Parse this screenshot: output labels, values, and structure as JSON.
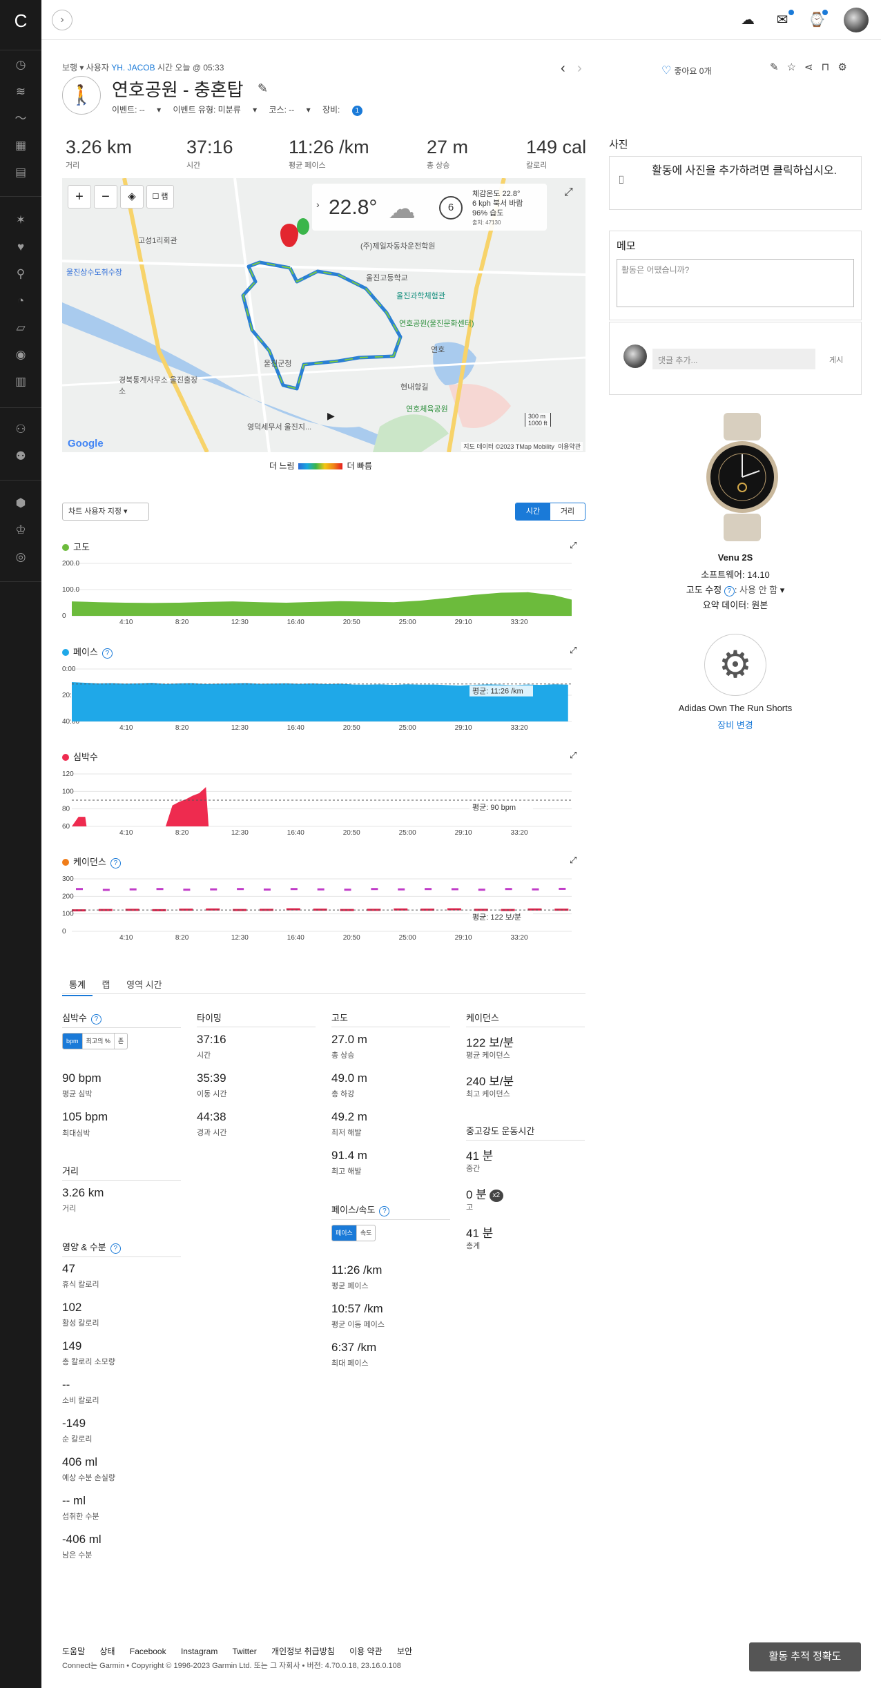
{
  "header": {
    "collapse_icon": "chevron-right-icon"
  },
  "breadcrumb": {
    "view": "보행",
    "user_prefix": "사용자",
    "user": "YH. JACOB",
    "time_prefix": "시간",
    "time": "오늘 @ 05:33"
  },
  "activity": {
    "title": "연호공원 - 충혼탑",
    "event": "이벤트: --",
    "event_type": "이벤트 유형: 미분류",
    "course": "코스: --",
    "gear": "장비:",
    "gear_count": "1",
    "likes": "좋아요 0개"
  },
  "stats": [
    {
      "value": "3.26 km",
      "label": "거리"
    },
    {
      "value": "37:16",
      "label": "시간"
    },
    {
      "value": "11:26 /km",
      "label": "평균 페이스"
    },
    {
      "value": "27 m",
      "label": "총 상승"
    },
    {
      "value": "149 cal",
      "label": "칼로리"
    }
  ],
  "map": {
    "lap_label": "랩",
    "weather": {
      "temp": "22.8°",
      "wind": "6",
      "feels": "체감온도 22.8°",
      "wind_text": "6 kph 북서 바람",
      "humidity": "96% 습도",
      "source": "출처: 47130"
    },
    "labels": {
      "a": "고성1리회관",
      "b": "울진상수도취수장",
      "c": "(주)제일자동차운전학원",
      "d": "울진고등학교",
      "e": "울진과학체험관",
      "f": "연호공원(울진문화센터)",
      "g": "경북통계사무소 울진출장소",
      "h": "영덕세무서 울진지...",
      "i": "연호체육공원",
      "j": "현내항길",
      "k": "연호",
      "l": "울진군청"
    },
    "credit": "지도 데이터 ©2023 TMap Mobility",
    "terms": "이용약관",
    "scale_m": "300 m",
    "scale_ft": "1000 ft",
    "google": "Google"
  },
  "speed_legend": {
    "slow": "더 느림",
    "fast": "더 빠름"
  },
  "chart_controls": {
    "settings": "차트 사용자 지정 ▾",
    "time": "시간",
    "distance": "거리"
  },
  "chart_data": [
    {
      "type": "area",
      "title": "고도",
      "color": "#6cbb3c",
      "x_ticks": [
        "4:10",
        "8:20",
        "12:30",
        "16:40",
        "20:50",
        "25:00",
        "29:10",
        "33:20"
      ],
      "y_ticks": [
        "200.0",
        "100.0",
        "0"
      ],
      "ylim": [
        0,
        200
      ],
      "x": [
        0,
        2,
        4,
        6,
        8,
        10,
        12,
        14,
        16,
        18,
        20,
        22,
        24,
        26,
        28,
        30,
        32,
        34,
        36,
        37.27
      ],
      "values": [
        55,
        52,
        50,
        49,
        50,
        53,
        55,
        52,
        50,
        53,
        56,
        54,
        52,
        58,
        68,
        80,
        88,
        90,
        78,
        62
      ]
    },
    {
      "type": "area",
      "title": "페이스",
      "color": "#1fa8e8",
      "x_ticks": [
        "4:10",
        "8:20",
        "12:30",
        "16:40",
        "20:50",
        "25:00",
        "29:10",
        "33:20"
      ],
      "y_ticks": [
        "0:00",
        "20:00",
        "40:00"
      ],
      "ylim": [
        0,
        40
      ],
      "avg_label": "평균: 11:26 /km",
      "x": [
        0,
        1,
        2,
        3,
        4,
        5,
        6,
        7,
        8,
        9,
        10,
        11,
        12,
        13,
        14,
        15,
        16,
        17,
        18,
        19,
        20,
        21,
        22,
        23,
        24,
        25,
        26,
        27,
        28,
        29,
        30,
        31,
        32,
        33,
        34,
        35,
        36,
        37
      ],
      "values": [
        10,
        10.5,
        11,
        10.8,
        11.2,
        11,
        10.6,
        11.4,
        11,
        10.8,
        11.5,
        11.2,
        11,
        10.7,
        11.3,
        11.1,
        10.9,
        11.4,
        11,
        11.6,
        11.2,
        11.9,
        12,
        11.8,
        12.2,
        11.7,
        12,
        11.9,
        12.3,
        12.6,
        12.1,
        11.8,
        12,
        12.4,
        11.9,
        12.2,
        11.7,
        12
      ]
    },
    {
      "type": "area",
      "title": "심박수",
      "color": "#ee2b4f",
      "x_ticks": [
        "4:10",
        "8:20",
        "12:30",
        "16:40",
        "20:50",
        "25:00",
        "29:10",
        "33:20"
      ],
      "y_ticks": [
        "120",
        "100",
        "80",
        "60"
      ],
      "ylim": [
        60,
        120
      ],
      "avg_label": "평균: 90 bpm",
      "x": [
        0,
        0.5,
        1,
        1.1,
        7,
        7.5,
        8,
        8.5,
        9,
        9.5,
        10,
        10.2
      ],
      "values": [
        60,
        71,
        71,
        60,
        60,
        84,
        88,
        91,
        95,
        98,
        105,
        60
      ]
    },
    {
      "type": "scatter",
      "title": "케이던스",
      "color": "#e0204a",
      "x_ticks": [
        "4:10",
        "8:20",
        "12:30",
        "16:40",
        "20:50",
        "25:00",
        "29:10",
        "33:20"
      ],
      "y_ticks": [
        "300",
        "200",
        "100",
        "0"
      ],
      "ylim": [
        0,
        300
      ],
      "avg_label": "평균: 122 보/분",
      "x": [
        0,
        2,
        4,
        6,
        8,
        10,
        12,
        14,
        16,
        18,
        20,
        22,
        24,
        26,
        28,
        30,
        32,
        34,
        36
      ],
      "values": [
        118,
        120,
        121,
        119,
        122,
        123,
        120,
        121,
        124,
        122,
        120,
        121,
        123,
        122,
        124,
        121,
        120,
        123,
        122
      ],
      "outliers": [
        240,
        235,
        238,
        240,
        236,
        238,
        240,
        237,
        240,
        238,
        236,
        240,
        238,
        240,
        239,
        236,
        240,
        238,
        241
      ]
    }
  ],
  "stat_tabs": [
    "통계",
    "랩",
    "영역 시간"
  ],
  "hr": {
    "title": "심박수",
    "seg": [
      "bpm",
      "최고의 %",
      "존"
    ],
    "avg": "90 bpm",
    "avg_l": "평균 심박",
    "max": "105 bpm",
    "max_l": "최대심박"
  },
  "distance": {
    "title": "거리",
    "value": "3.26 km",
    "label": "거리"
  },
  "nutrition": {
    "title": "영양 & 수분",
    "items": [
      {
        "v": "47",
        "l": "휴식 칼로리"
      },
      {
        "v": "102",
        "l": "활성 칼로리"
      },
      {
        "v": "149",
        "l": "총 칼로리 소모량"
      },
      {
        "v": "--",
        "l": "소비 칼로리"
      },
      {
        "v": "-149",
        "l": "순 칼로리"
      },
      {
        "v": "406 ml",
        "l": "예상 수분 손실량"
      },
      {
        "v": "-- ml",
        "l": "섭취한 수분"
      },
      {
        "v": "-406 ml",
        "l": "남은 수분"
      }
    ]
  },
  "timing": {
    "title": "타이밍",
    "items": [
      {
        "v": "37:16",
        "l": "시간"
      },
      {
        "v": "35:39",
        "l": "이동 시간"
      },
      {
        "v": "44:38",
        "l": "경과 시간"
      }
    ]
  },
  "elevation": {
    "title": "고도",
    "items": [
      {
        "v": "27.0 m",
        "l": "총 상승"
      },
      {
        "v": "49.0 m",
        "l": "총 하강"
      },
      {
        "v": "49.2 m",
        "l": "최저 해발"
      },
      {
        "v": "91.4 m",
        "l": "최고 해발"
      }
    ]
  },
  "pace": {
    "title": "페이스/속도",
    "seg": [
      "페이스",
      "속도"
    ],
    "items": [
      {
        "v": "11:26 /km",
        "l": "평균 페이스"
      },
      {
        "v": "10:57 /km",
        "l": "평균 이동 페이스"
      },
      {
        "v": "6:37 /km",
        "l": "최대 페이스"
      }
    ]
  },
  "cadence": {
    "title": "케이던스",
    "items": [
      {
        "v": "122 보/분",
        "l": "평균 케이던스"
      },
      {
        "v": "240 보/분",
        "l": "최고 케이던스"
      }
    ]
  },
  "intensity": {
    "title": "중고강도 운동시간",
    "items": [
      {
        "v": "41 분",
        "l": "중간"
      },
      {
        "v": "0 분",
        "l": "고",
        "badge": "x2"
      },
      {
        "v": "41 분",
        "l": "총계"
      }
    ]
  },
  "side": {
    "photos_title": "사진",
    "photos_text": "활동에 사진을 추가하려면 클릭하십시오.",
    "memo_title": "메모",
    "memo_placeholder": "활동은 어땠습니까?",
    "comment_placeholder": "댓글 추가...",
    "comment_post": "게시",
    "device_name": "Venu 2S",
    "software": "소프트웨어: 14.10",
    "elev_corr_label": "고도 수정",
    "elev_corr_value": ": 사용 안 함",
    "summary_data": "요약 데이터: 원본",
    "gear_name": "Adidas Own The Run Shorts",
    "gear_change": "장비 변경"
  },
  "footer": {
    "links": [
      "도움말",
      "상태",
      "Facebook",
      "Instagram",
      "Twitter",
      "개인정보 취급방침",
      "이용 약관",
      "보안"
    ],
    "copyright": "Connect는 Garmin • Copyright © 1996-2023 Garmin Ltd. 또는 그 자회사 • 버전: 4.70.0.18, 23.16.0.108",
    "track_button": "활동 추적 정확도"
  }
}
